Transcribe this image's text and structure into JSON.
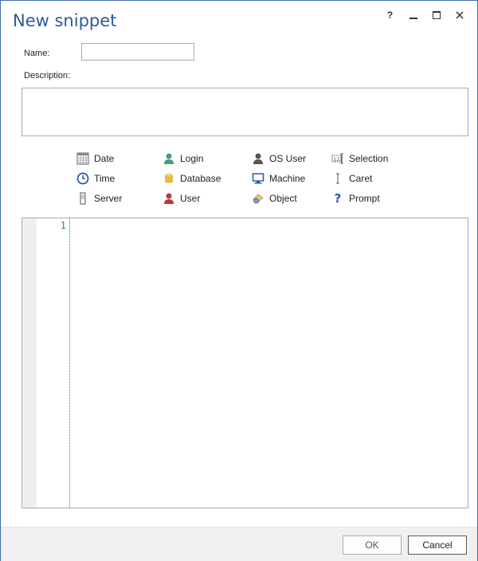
{
  "window": {
    "title": "New snippet",
    "help_label": "?"
  },
  "form": {
    "name_label": "Name:",
    "name_value": "",
    "description_label": "Description:",
    "description_value": ""
  },
  "variables": [
    {
      "label": "Date",
      "icon": "calendar-icon"
    },
    {
      "label": "Login",
      "icon": "login-user-icon"
    },
    {
      "label": "OS User",
      "icon": "os-user-icon"
    },
    {
      "label": "Selection",
      "icon": "selection-icon"
    },
    {
      "label": "Time",
      "icon": "clock-icon"
    },
    {
      "label": "Database",
      "icon": "database-icon"
    },
    {
      "label": "Machine",
      "icon": "monitor-icon"
    },
    {
      "label": "Caret",
      "icon": "caret-icon"
    },
    {
      "label": "Server",
      "icon": "server-icon"
    },
    {
      "label": "User",
      "icon": "user-icon"
    },
    {
      "label": "Object",
      "icon": "object-icon"
    },
    {
      "label": "Prompt",
      "icon": "question-icon"
    }
  ],
  "editor": {
    "line_numbers": [
      "1"
    ]
  },
  "buttons": {
    "ok": "OK",
    "cancel": "Cancel"
  },
  "colors": {
    "title": "#2b5b9b",
    "border": "#3b6ea5",
    "line_number": "#2a8a8a"
  }
}
